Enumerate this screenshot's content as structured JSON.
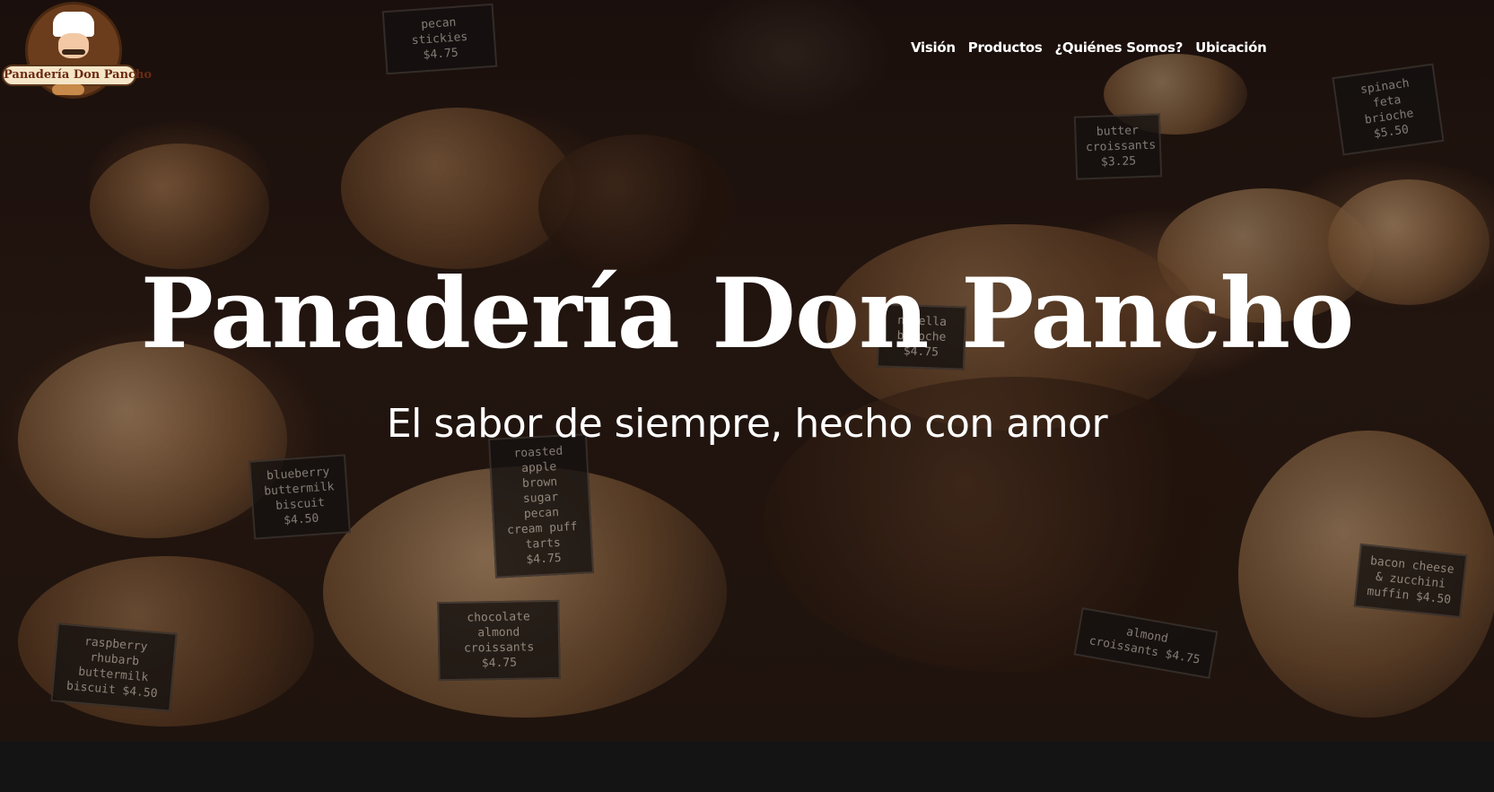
{
  "brand": {
    "logo_text": "Panadería Don Pancho"
  },
  "nav": {
    "items": [
      {
        "label": "Visión"
      },
      {
        "label": "Productos"
      },
      {
        "label": "¿Quiénes Somos?"
      },
      {
        "label": "Ubicación"
      }
    ]
  },
  "hero": {
    "title": "Panadería Don Pancho",
    "subtitle": "El sabor de siempre, hecho con amor",
    "price_signs": [
      {
        "text": "pecan stickies $4.75"
      },
      {
        "text": "butter croissants $3.25"
      },
      {
        "text": "spinach feta brioche $5.50"
      },
      {
        "text": "blueberry buttermilk biscuit $4.50"
      },
      {
        "text": "roasted apple brown sugar pecan cream puff tarts $4.75"
      },
      {
        "text": "chocolate almond croissants $4.75"
      },
      {
        "text": "almond croissants $4.75"
      },
      {
        "text": "raspberry rhubarb buttermilk biscuit $4.50"
      },
      {
        "text": "bacon cheese & zucchini muffin $4.50"
      },
      {
        "text": "nutella brioche $4.75"
      }
    ]
  }
}
